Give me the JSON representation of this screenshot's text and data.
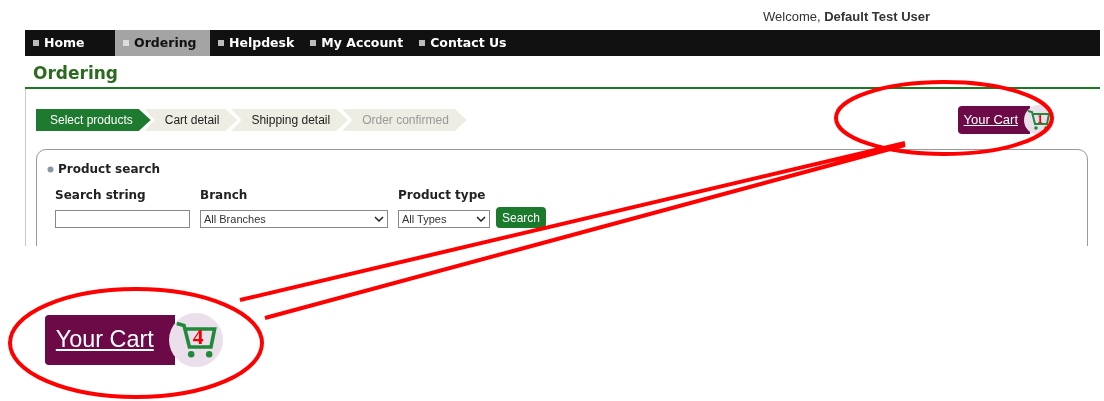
{
  "welcome": {
    "greeting": "Welcome,",
    "user": "Default Test User"
  },
  "nav": [
    {
      "label": "Home",
      "selected": false
    },
    {
      "label": "Ordering",
      "selected": true
    },
    {
      "label": "Helpdesk",
      "selected": false
    },
    {
      "label": "My Account",
      "selected": false
    },
    {
      "label": "Contact Us",
      "selected": false
    }
  ],
  "page_title": "Ordering",
  "steps": [
    {
      "label": "Select products",
      "selected": true,
      "disabled": false
    },
    {
      "label": "Cart detail",
      "selected": false,
      "disabled": false
    },
    {
      "label": "Shipping detail",
      "selected": false,
      "disabled": false
    },
    {
      "label": "Order confirmed",
      "selected": false,
      "disabled": true
    }
  ],
  "cart": {
    "label": "Your Cart",
    "count": "1"
  },
  "product_search": {
    "title": "Product search",
    "fields": [
      {
        "kind": "text",
        "label": "Search string"
      },
      {
        "kind": "select",
        "label": "Branch",
        "value": "All Branches"
      },
      {
        "kind": "select",
        "label": "Product type",
        "value": "All Types"
      }
    ],
    "button": "Search"
  },
  "callout": {
    "cart": {
      "label": "Your Cart",
      "count": "4"
    }
  }
}
